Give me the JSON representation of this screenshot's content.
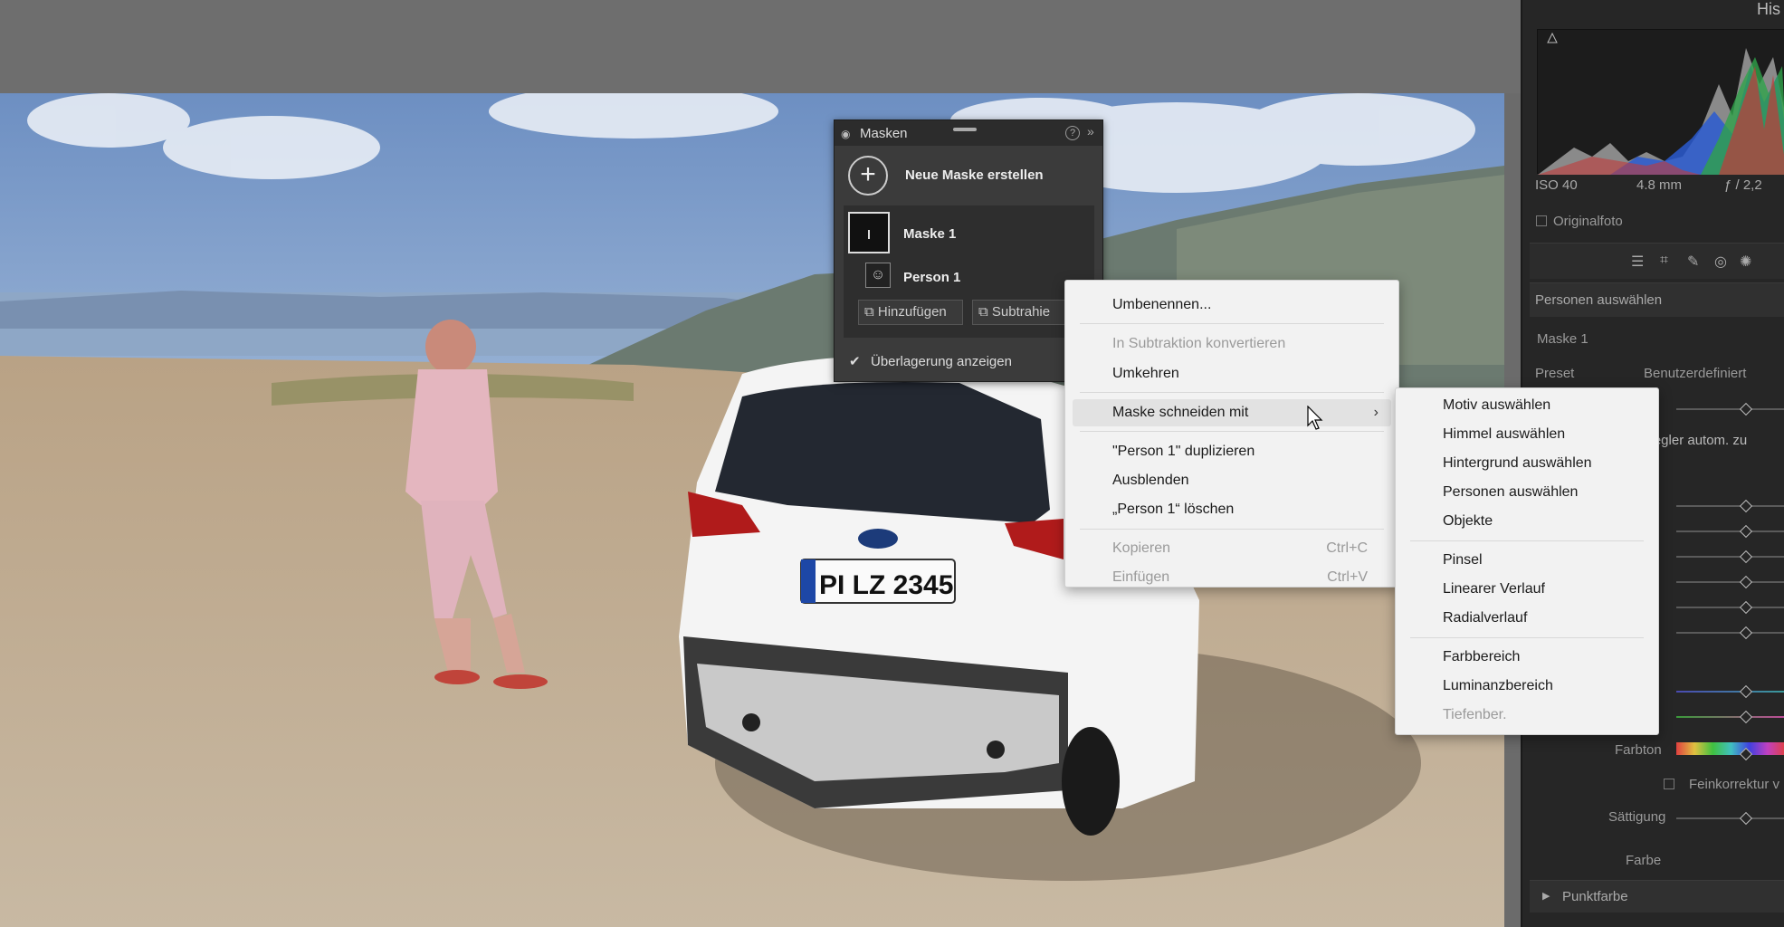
{
  "right_panel": {
    "title": "His",
    "histogram_info": {
      "iso": "ISO 40",
      "focal": "4.8 mm",
      "aperture": "ƒ / 2,2"
    },
    "original_photo_label": "Originalfoto",
    "select_people_header": "Personen auswählen",
    "mask_name": "Maske 1",
    "preset_label": "Preset",
    "preset_value": "Benutzerdefiniert",
    "auto_label": "Regler autom. zu",
    "hue_label": "Farbton",
    "fine_label": "Feinkorrektur v",
    "saturation_label": "Sättigung",
    "color_label": "Farbe",
    "spot_color_label": "Punktfarbe"
  },
  "masks_panel": {
    "title": "Masken",
    "new_mask_label": "Neue Maske erstellen",
    "mask1_label": "Maske 1",
    "person1_label": "Person 1",
    "add_button": "Hinzufügen",
    "subtract_button": "Subtrahie",
    "overlay_label": "Überlagerung anzeigen",
    "overlay_color": "#d4200f"
  },
  "context_menu": {
    "rename": "Umbenennen...",
    "convert_subtraction": "In Subtraktion konvertieren",
    "invert": "Umkehren",
    "intersect_with": "Maske schneiden mit",
    "duplicate": "\"Person 1\" duplizieren",
    "hide": "Ausblenden",
    "delete": "„Person 1“ löschen",
    "copy": "Kopieren",
    "copy_shortcut": "Ctrl+C",
    "paste": "Einfügen",
    "paste_shortcut": "Ctrl+V"
  },
  "submenu": {
    "items_group1": [
      "Motiv auswählen",
      "Himmel auswählen",
      "Hintergrund auswählen",
      "Personen auswählen",
      "Objekte"
    ],
    "items_group2": [
      "Pinsel",
      "Linearer Verlauf",
      "Radialverlauf"
    ],
    "items_group3": [
      "Farbbereich",
      "Luminanzbereich"
    ],
    "items_disabled": [
      "Tiefenber."
    ]
  },
  "photo": {
    "license_plate": "PI LZ 2345"
  }
}
